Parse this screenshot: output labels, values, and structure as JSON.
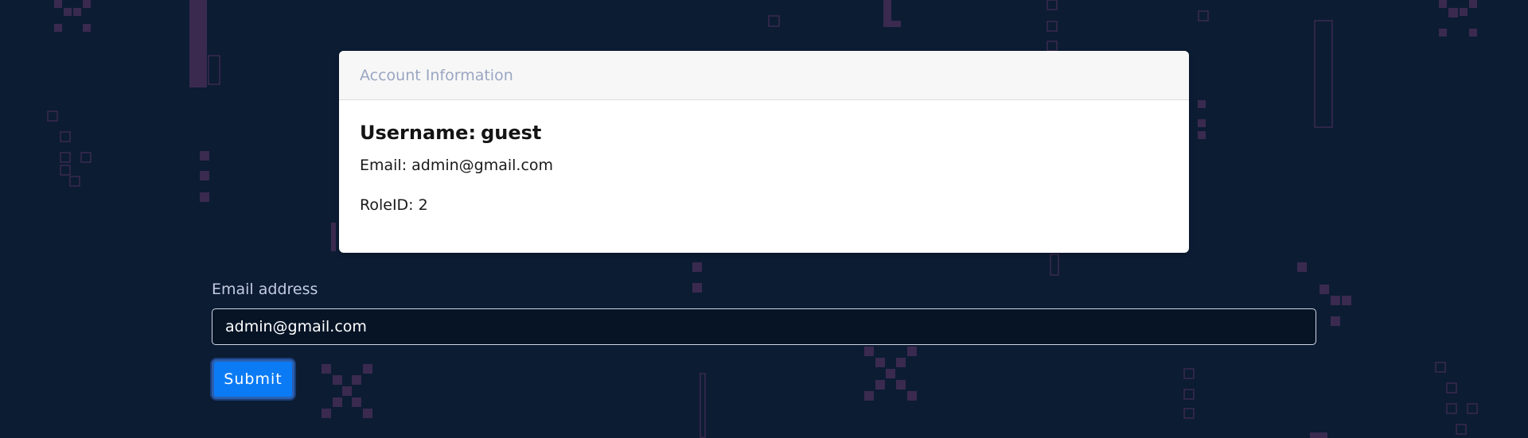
{
  "card": {
    "header": "Account Information",
    "username_label": "Username:",
    "username_value": "guest",
    "email_label": "Email:",
    "email_value": "admin@gmail.com",
    "roleid_label": "RoleID:",
    "roleid_value": "2"
  },
  "form": {
    "email_label": "Email address",
    "email_value": "admin@gmail.com",
    "submit_label": "Submit"
  },
  "colors": {
    "background": "#0c1c33",
    "decor_purple": "#3a2a4f",
    "button": "#0b7bf5"
  }
}
